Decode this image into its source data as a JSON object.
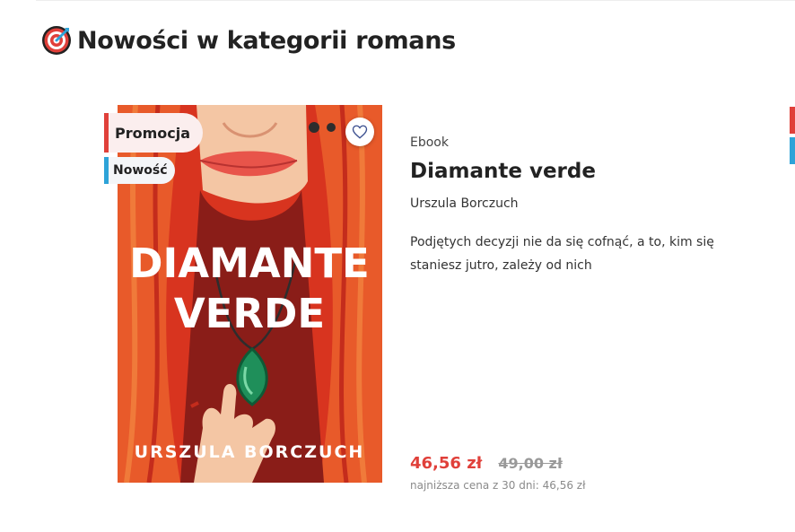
{
  "section": {
    "icon": "target-icon",
    "title": "Nowości w kategorii romans"
  },
  "product": {
    "badges": {
      "promo": "Promocja",
      "new": "Nowość"
    },
    "cover": {
      "title_line1": "DIAMANTE",
      "title_line2": "VERDE",
      "author": "URSZULA BORCZUCH"
    },
    "format": "Ebook",
    "title": "Diamante verde",
    "author": "Urszula Borczuch",
    "description": "Podjętych decyzji nie da się cofnąć, a to, kim się staniesz jutro, zależy od nich",
    "price_current": "46,56 zł",
    "price_old": "49,00 zł",
    "lowest_price_note": "najniższa cena z 30 dni: 46,56 zł"
  },
  "colors": {
    "accent_red": "#e0403a",
    "accent_blue": "#2ea3d8"
  }
}
